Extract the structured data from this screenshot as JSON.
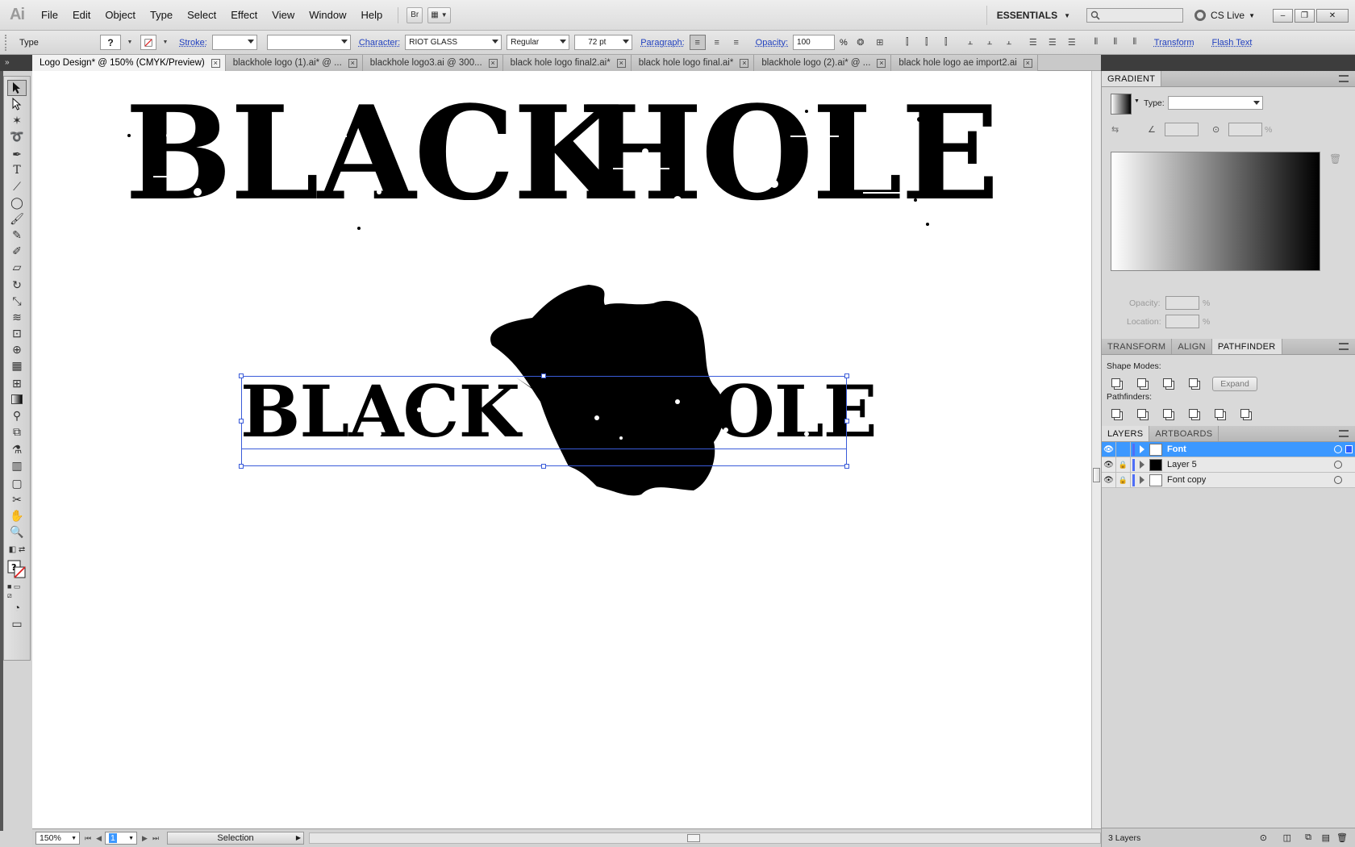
{
  "app": {
    "logo": "Ai"
  },
  "menu": [
    "File",
    "Edit",
    "Object",
    "Type",
    "Select",
    "Effect",
    "View",
    "Window",
    "Help"
  ],
  "menubar_buttons": {
    "bridge": "Br",
    "arrange": "▦"
  },
  "workspace": {
    "label": "ESSENTIALS"
  },
  "search": {
    "placeholder": ""
  },
  "cslive": {
    "label": "CS Live"
  },
  "window_controls": {
    "minimize": "–",
    "restore": "❐",
    "close": "✕"
  },
  "control_bar": {
    "tool_label": "Type",
    "stroke_label": "Stroke:",
    "character_label": "Character:",
    "font_family": "RIOT GLASS",
    "font_style": "Regular",
    "font_size": "72 pt",
    "paragraph_label": "Paragraph:",
    "opacity_label": "Opacity:",
    "opacity_value": "100",
    "opacity_unit": "%",
    "transform_link": "Transform",
    "flash_text_link": "Flash Text"
  },
  "doc_tabs": [
    {
      "label": "Logo Design* @ 150% (CMYK/Preview)",
      "active": true
    },
    {
      "label": "blackhole logo (1).ai* @ ...",
      "active": false
    },
    {
      "label": "blackhole logo3.ai @ 300...",
      "active": false
    },
    {
      "label": "black hole logo final2.ai*",
      "active": false
    },
    {
      "label": "black hole logo final.ai*",
      "active": false
    },
    {
      "label": "blackhole logo (2).ai* @ ...",
      "active": false
    },
    {
      "label": "black hole logo ae import2.ai",
      "active": false
    }
  ],
  "canvas": {
    "logo_top": {
      "word1": "BLACK",
      "word2": "HOLE"
    },
    "logo_bottom": {
      "word1": "BLACK",
      "word2": "HOLE"
    }
  },
  "status_bar": {
    "zoom": "150%",
    "artboard": "1",
    "status": "Selection"
  },
  "panels": {
    "gradient": {
      "title": "GRADIENT",
      "type_label": "Type:",
      "opacity_label": "Opacity:",
      "location_label": "Location:",
      "percent": "%"
    },
    "tabs2": [
      "TRANSFORM",
      "ALIGN",
      "PATHFINDER"
    ],
    "pathfinder": {
      "shape_modes_label": "Shape Modes:",
      "expand_label": "Expand",
      "pathfinders_label": "Pathfinders:"
    },
    "layers_tabs": [
      "LAYERS",
      "ARTBOARDS"
    ],
    "layers": [
      {
        "name": "Font",
        "selected": true
      },
      {
        "name": "Layer 5",
        "selected": false
      },
      {
        "name": "Font copy",
        "selected": false
      }
    ],
    "layers_count": "3 Layers"
  },
  "colors": {
    "selection": "#3c98ff",
    "bbox": "#3a5bd9",
    "link": "#1f3fbf"
  }
}
